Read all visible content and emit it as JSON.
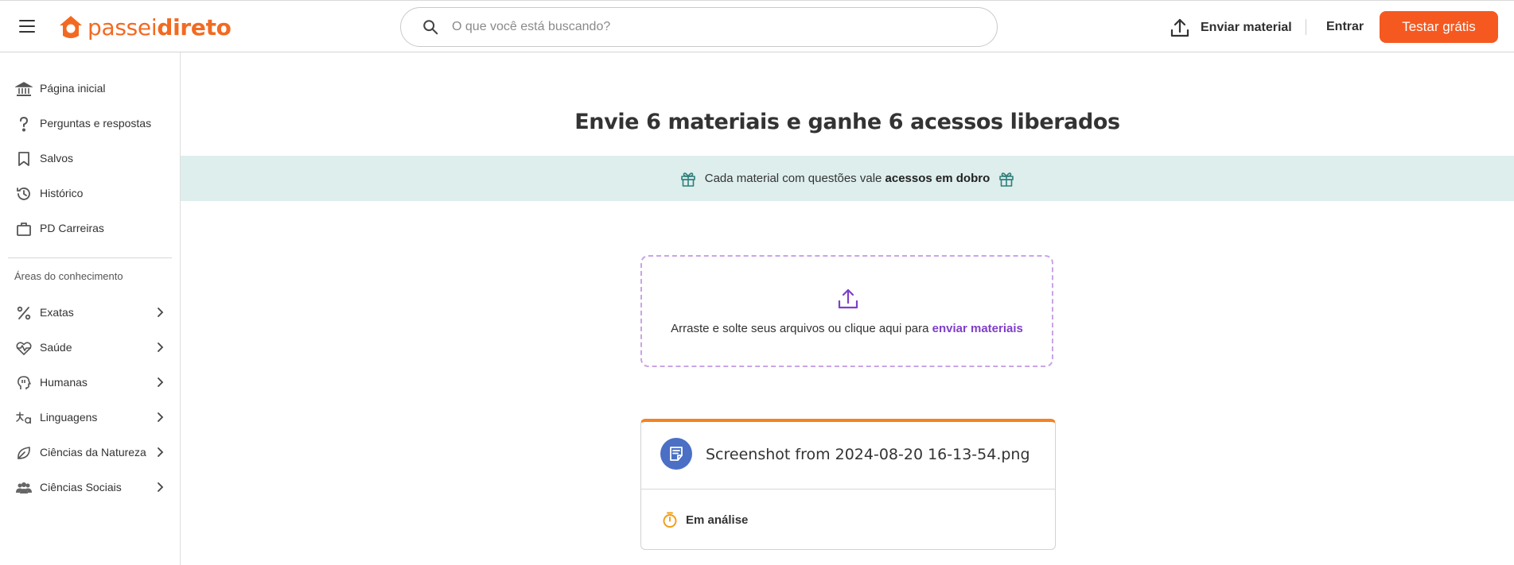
{
  "header": {
    "logo_light": "passei",
    "logo_bold": "direto",
    "search_placeholder": "O que você está buscando?",
    "upload_label": "Enviar material",
    "login_label": "Entrar",
    "cta_label": "Testar grátis"
  },
  "sidebar": {
    "items": [
      {
        "label": "Página inicial",
        "icon": "bank-icon"
      },
      {
        "label": "Perguntas e respostas",
        "icon": "question-icon"
      },
      {
        "label": "Salvos",
        "icon": "bookmark-icon"
      },
      {
        "label": "Histórico",
        "icon": "history-icon"
      },
      {
        "label": "PD Carreiras",
        "icon": "briefcase-icon"
      }
    ],
    "areas_heading": "Áreas do conhecimento",
    "areas": [
      {
        "label": "Exatas",
        "icon": "percent-icon"
      },
      {
        "label": "Saúde",
        "icon": "heartbeat-icon"
      },
      {
        "label": "Humanas",
        "icon": "head-icon"
      },
      {
        "label": "Linguagens",
        "icon": "translate-icon"
      },
      {
        "label": "Ciências da Natureza",
        "icon": "leaf-icon"
      },
      {
        "label": "Ciências Sociais",
        "icon": "people-icon"
      }
    ]
  },
  "main": {
    "headline": {
      "part1": "Envie ",
      "bold1": "6 materiais",
      "part2": " e ganhe ",
      "bold2": "6 acessos",
      "part3": " liberados"
    },
    "banner": {
      "text": "Cada material com questões vale ",
      "bold": "acessos em dobro"
    },
    "dropzone": {
      "text": "Arraste e solte seus arquivos ou clique aqui para ",
      "link": "enviar materiais"
    },
    "file": {
      "name": "Screenshot from 2024-08-20 16-13-54.png",
      "status": "Em análise"
    }
  },
  "colors": {
    "brand": "#f26a21",
    "cta": "#f5591f",
    "banner_bg": "#ddeeed",
    "banner_icon": "#2e7f7a",
    "accent_purple": "#7f3fc8",
    "progress_orange": "#f58220",
    "file_icon_bg": "#4a6fc4"
  }
}
